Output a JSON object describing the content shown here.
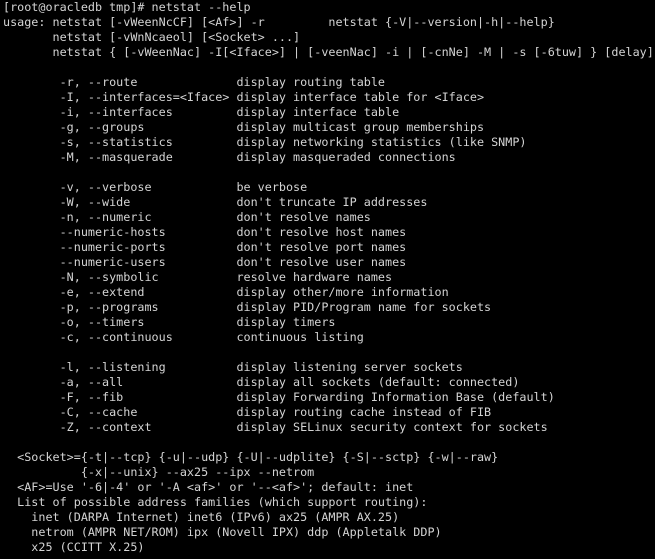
{
  "terminal": {
    "lines": [
      "[root@oracledb tmp]# netstat --help",
      "usage: netstat [-vWeenNcCF] [<Af>] -r         netstat {-V|--version|-h|--help}",
      "       netstat [-vWnNcaeol] [<Socket> ...]",
      "       netstat { [-vWeenNac] -I[<Iface>] | [-veenNac] -i | [-cnNe] -M | -s [-6tuw] } [delay]",
      "",
      "        -r, --route              display routing table",
      "        -I, --interfaces=<Iface> display interface table for <Iface>",
      "        -i, --interfaces         display interface table",
      "        -g, --groups             display multicast group memberships",
      "        -s, --statistics         display networking statistics (like SNMP)",
      "        -M, --masquerade         display masqueraded connections",
      "",
      "        -v, --verbose            be verbose",
      "        -W, --wide               don't truncate IP addresses",
      "        -n, --numeric            don't resolve names",
      "        --numeric-hosts          don't resolve host names",
      "        --numeric-ports          don't resolve port names",
      "        --numeric-users          don't resolve user names",
      "        -N, --symbolic           resolve hardware names",
      "        -e, --extend             display other/more information",
      "        -p, --programs           display PID/Program name for sockets",
      "        -o, --timers             display timers",
      "        -c, --continuous         continuous listing",
      "",
      "        -l, --listening          display listening server sockets",
      "        -a, --all                display all sockets (default: connected)",
      "        -F, --fib                display Forwarding Information Base (default)",
      "        -C, --cache              display routing cache instead of FIB",
      "        -Z, --context            display SELinux security context for sockets",
      "",
      "  <Socket>={-t|--tcp} {-u|--udp} {-U|--udplite} {-S|--sctp} {-w|--raw}",
      "           {-x|--unix} --ax25 --ipx --netrom",
      "  <AF>=Use '-6|-4' or '-A <af>' or '--<af>'; default: inet",
      "  List of possible address families (which support routing):",
      "    inet (DARPA Internet) inet6 (IPv6) ax25 (AMPR AX.25)",
      "    netrom (AMPR NET/ROM) ipx (Novell IPX) ddp (Appletalk DDP)",
      "    x25 (CCITT X.25)"
    ]
  }
}
